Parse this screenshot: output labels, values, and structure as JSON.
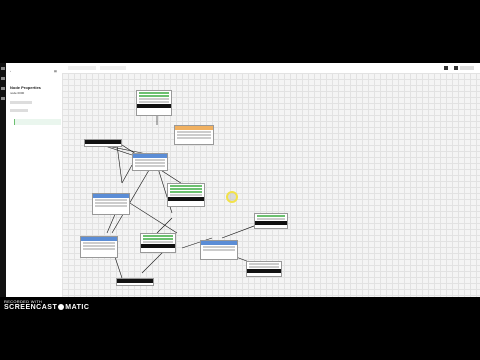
{
  "panel": {
    "title": "Node Properties",
    "subtitle": "node 0000"
  },
  "toolbar": {
    "left_button_1": "",
    "left_button_2": ""
  },
  "watermark": {
    "top": "RECORDED WITH",
    "brand_left": "SCREENCAST",
    "brand_right": "MATIC"
  }
}
